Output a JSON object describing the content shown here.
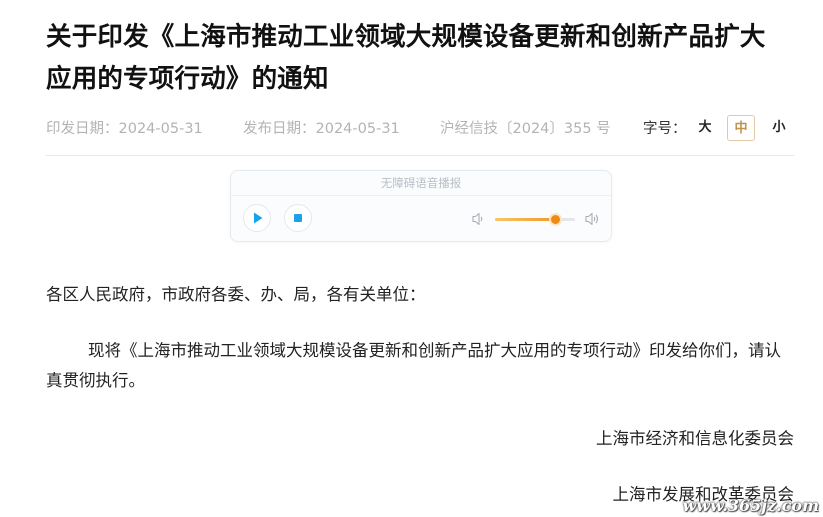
{
  "article": {
    "title": "关于印发《上海市推动工业领域大规模设备更新和创新产品扩大应用的专项行动》的通知",
    "meta": {
      "print_date": "印发日期：2024-05-31",
      "publish_date": "发布日期：2024-05-31",
      "doc_number": "沪经信技〔2024〕355 号"
    },
    "font_size": {
      "label": "字号：",
      "large": "大",
      "medium": "中",
      "small": "小",
      "active": "medium"
    },
    "body": {
      "greeting": "各区人民政府，市政府各委、办、局，各有关单位：",
      "paragraph": "现将《上海市推动工业领域大规模设备更新和创新产品扩大应用的专项行动》印发给你们，请认真贯彻执行。"
    },
    "signatures": [
      "上海市经济和信息化委员会",
      "上海市发展和改革委员会"
    ]
  },
  "player": {
    "label": "无障碍语音播报",
    "play_icon": "play-icon",
    "stop_icon": "stop-icon",
    "volume_low_icon": "volume-low-icon",
    "volume_high_icon": "volume-high-icon",
    "volume_level": 0.75,
    "accent_color": "#1aa3e8",
    "slider_color": "#ef8a15"
  },
  "watermark": "www.365jz.com"
}
